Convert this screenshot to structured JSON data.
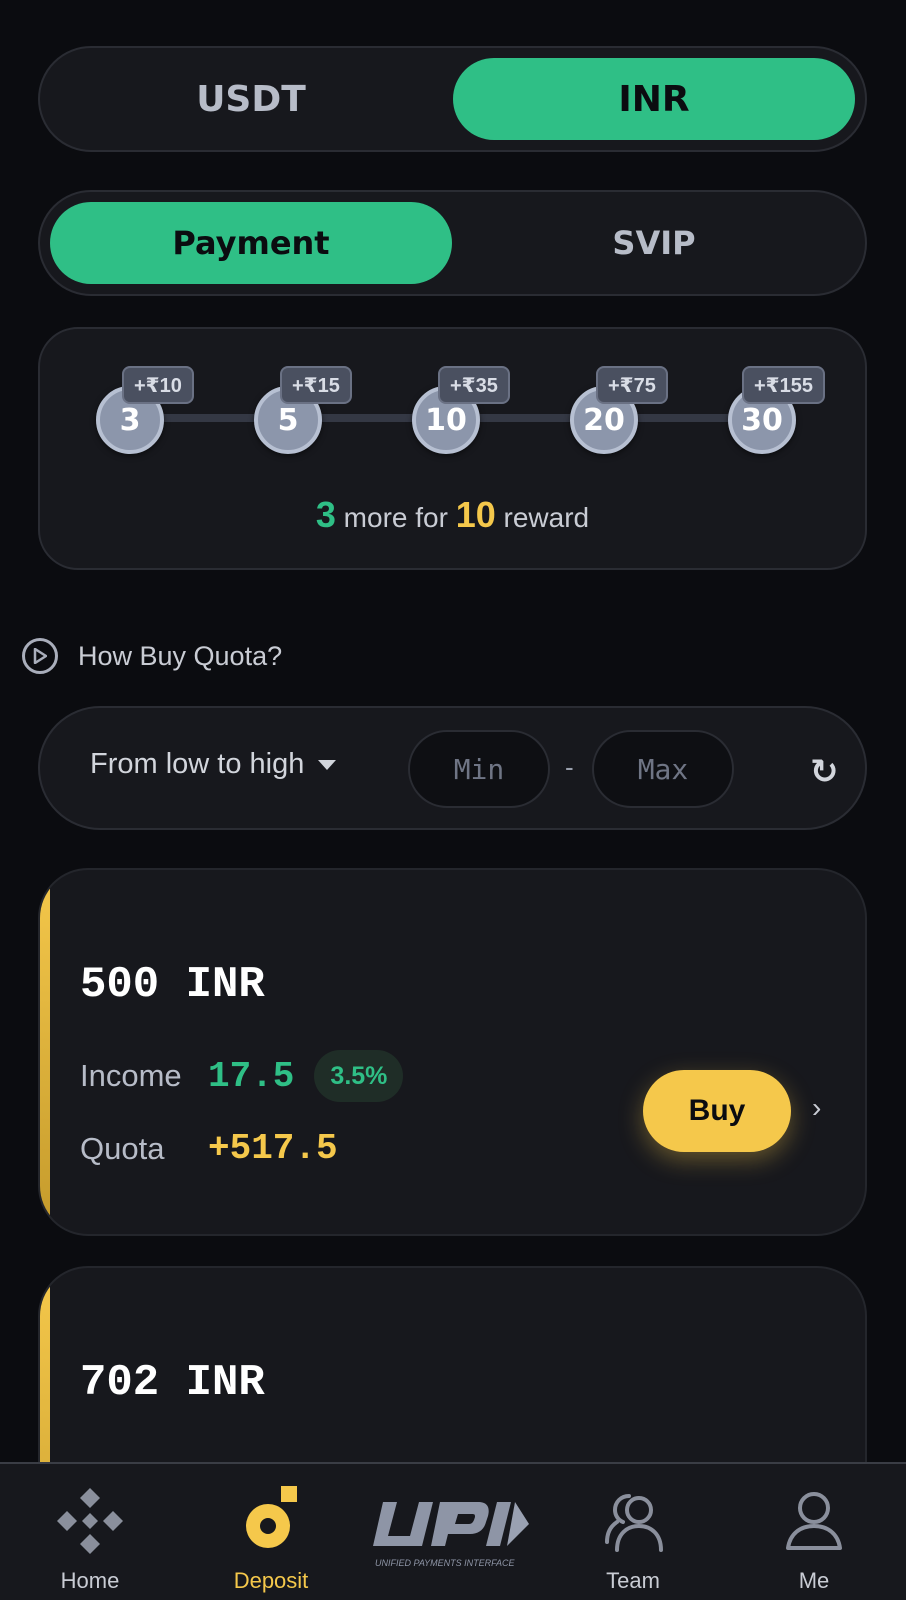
{
  "tabs_currency": {
    "left": "USDT",
    "right": "INR",
    "active": "INR"
  },
  "tabs_mode": {
    "left": "Payment",
    "right": "SVIP",
    "active": "Payment"
  },
  "rewards": {
    "milestones": [
      {
        "count": "3",
        "bonus": "+₹10"
      },
      {
        "count": "5",
        "bonus": "+₹15"
      },
      {
        "count": "10",
        "bonus": "+₹35"
      },
      {
        "count": "20",
        "bonus": "+₹75"
      },
      {
        "count": "30",
        "bonus": "+₹155"
      }
    ],
    "remaining": "3",
    "mid_text": "more for",
    "target": "10",
    "end_text": "reward"
  },
  "howto": {
    "label": "How Buy Quota?"
  },
  "filter": {
    "sort_label": "From low to high",
    "min_placeholder": "Min",
    "max_placeholder": "Max",
    "separator": "-"
  },
  "offers": [
    {
      "amount": "500 INR",
      "income_label": "Income",
      "income": "17.5",
      "rate": "3.5%",
      "quota_label": "Quota",
      "quota": "+517.5",
      "buy_label": "Buy"
    },
    {
      "amount": "702 INR"
    }
  ],
  "nav": {
    "items": [
      {
        "label": "Home"
      },
      {
        "label": "Deposit"
      },
      {
        "label": "UPI"
      },
      {
        "label": "Team"
      },
      {
        "label": "Me"
      }
    ],
    "upi_subtitle": "UNIFIED PAYMENTS INTERFACE",
    "active": "Deposit"
  },
  "colors": {
    "accent_green": "#2fbf86",
    "accent_yellow": "#f5c84b",
    "background": "#0b0c10",
    "card": "#17181d"
  }
}
